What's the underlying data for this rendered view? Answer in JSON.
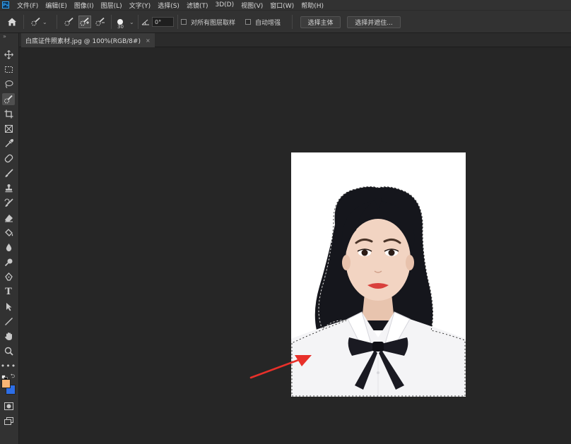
{
  "menu": {
    "items": [
      "文件(F)",
      "编辑(E)",
      "图像(I)",
      "图层(L)",
      "文字(Y)",
      "选择(S)",
      "滤镜(T)",
      "3D(D)",
      "视图(V)",
      "窗口(W)",
      "帮助(H)"
    ]
  },
  "options": {
    "brush_size": "30",
    "angle": "0°",
    "sample_all_layers": "对所有图层取样",
    "auto_enhance": "自动增强",
    "select_subject": "选择主体",
    "select_and_mask": "选择并遮住..."
  },
  "document": {
    "tab_title": "白底证件照素材.jpg @ 100%(RGB/8#)",
    "close_glyph": "×"
  },
  "colors": {
    "foreground": "#f7b575",
    "background": "#2d6ee6",
    "annotation_arrow": "#e8302a"
  },
  "toolbar_icons": [
    "move-icon",
    "marquee-icon",
    "lasso-icon",
    "quick-selection-icon",
    "crop-icon",
    "frame-icon",
    "eyedropper-icon",
    "healing-brush-icon",
    "brush-icon",
    "clone-stamp-icon",
    "history-brush-icon",
    "eraser-icon",
    "paint-bucket-icon",
    "blur-icon",
    "dodge-icon",
    "pen-icon",
    "type-icon",
    "path-selection-icon",
    "line-icon",
    "hand-icon",
    "zoom-icon",
    "more-tools-icon"
  ]
}
